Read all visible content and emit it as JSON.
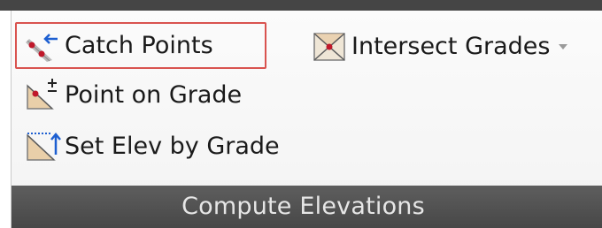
{
  "ribbon_panel": {
    "title": "Compute Elevations",
    "commands": {
      "catch_points": {
        "label": "Catch Points",
        "icon": "catch-points-icon",
        "highlighted": true
      },
      "intersect_grades": {
        "label": "Intersect Grades",
        "icon": "intersect-grades-icon",
        "has_dropdown": true
      },
      "point_on_grade": {
        "label": "Point on Grade",
        "icon": "point-on-grade-icon"
      },
      "set_elev_by_grade": {
        "label": "Set Elev by Grade",
        "icon": "set-elev-by-grade-icon"
      }
    }
  },
  "colors": {
    "highlight_border": "#d9534f",
    "panel_label_bar": "#4f4f4f",
    "icon_red": "#c0182a",
    "icon_blue": "#1d5fd1"
  }
}
